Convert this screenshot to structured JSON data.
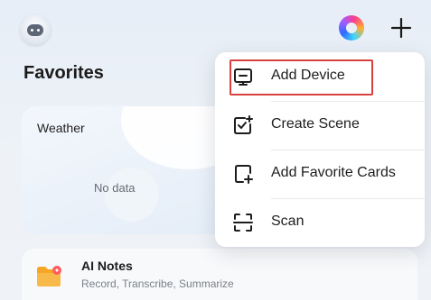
{
  "header": {
    "title": "Favorites"
  },
  "weather_card": {
    "title": "Weather",
    "status": "No data"
  },
  "notes_card": {
    "title": "AI Notes",
    "subtitle": "Record, Transcribe, Summarize"
  },
  "menu": {
    "items": [
      {
        "label": "Add Device",
        "icon": "add-device-icon"
      },
      {
        "label": "Create Scene",
        "icon": "create-scene-icon"
      },
      {
        "label": "Add Favorite Cards",
        "icon": "add-favorite-cards-icon"
      },
      {
        "label": "Scan",
        "icon": "scan-icon"
      }
    ]
  },
  "colors": {
    "highlight": "#d94040",
    "menu_bg": "#ffffff",
    "page_bg": "#e9eef5"
  }
}
